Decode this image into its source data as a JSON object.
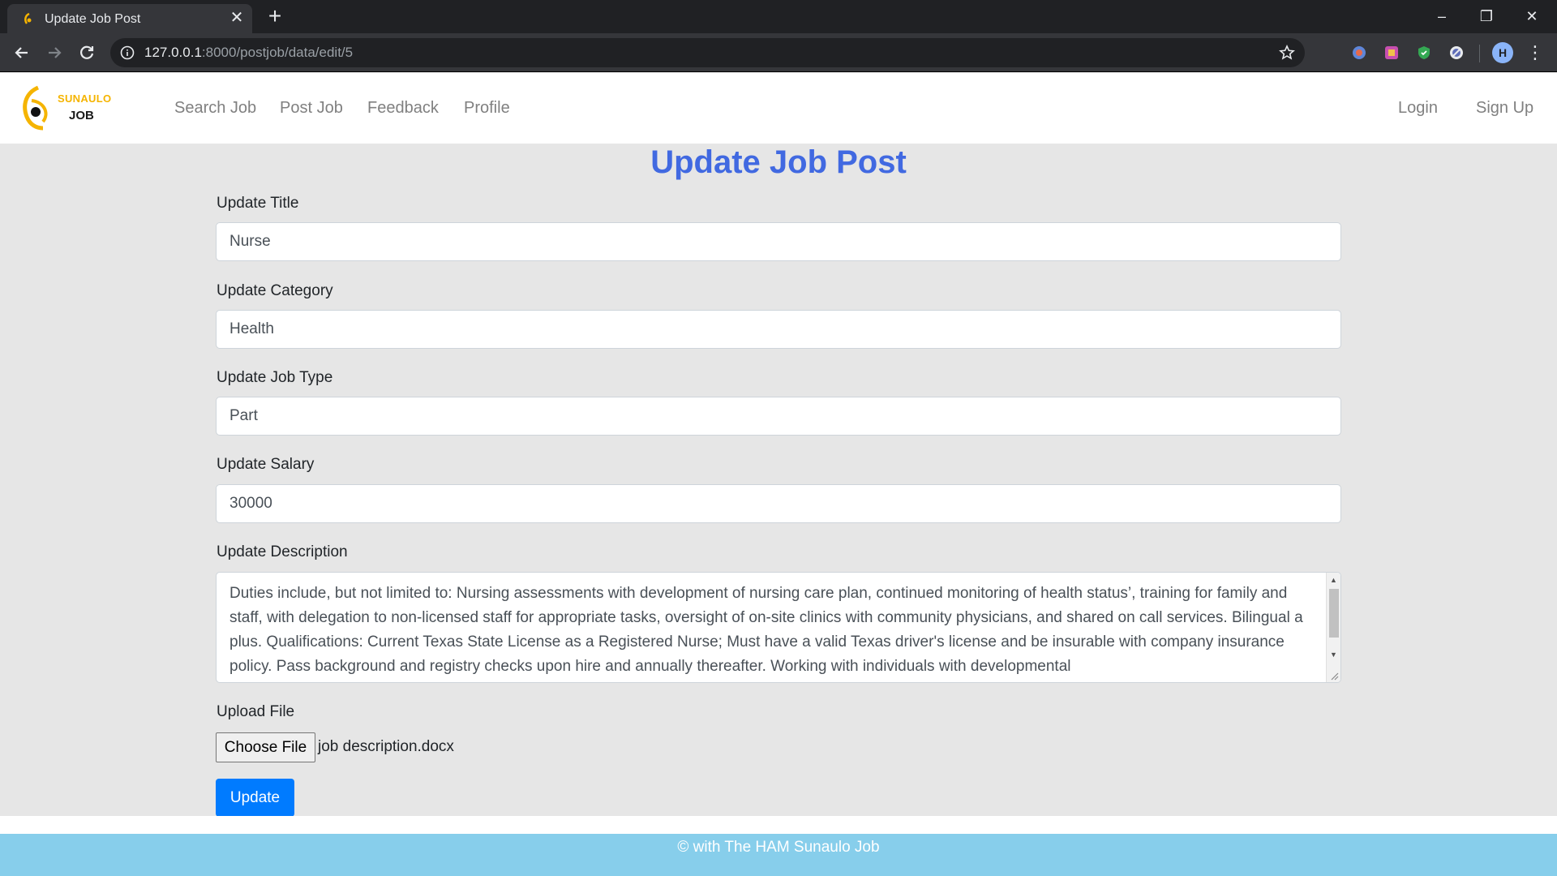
{
  "browser": {
    "tab_title": "Update Job Post",
    "tab_close": "✕",
    "new_tab": "+",
    "url_host": "127.0.0.1",
    "url_path": ":8000/postjob/data/edit/5",
    "window_controls": {
      "minimize": "–",
      "restore": "❐",
      "close": "✕"
    },
    "profile_initial": "H",
    "menu": "⋮"
  },
  "navbar": {
    "logo_top": "SUNAULO",
    "logo_bottom": "JOB",
    "links": [
      "Search Job",
      "Post Job",
      "Feedback",
      "Profile"
    ],
    "login": "Login",
    "signup": "Sign Up"
  },
  "form": {
    "heading": "Update Job Post",
    "title_label": "Update Title",
    "title_value": "Nurse",
    "category_label": "Update Category",
    "category_value": "Health",
    "jobtype_label": "Update Job Type",
    "jobtype_value": "Part",
    "salary_label": "Update Salary",
    "salary_value": "30000",
    "description_label": "Update Description",
    "description_value": "Duties include, but not limited to: Nursing assessments with development of nursing care plan, continued monitoring of health status’, training for family and staff, with delegation to non-licensed staff for appropriate tasks, oversight of on-site clinics with community physicians, and shared on call services. Bilingual a plus. Qualifications: Current Texas State License as a Registered Nurse; Must have a valid Texas driver's license and be insurable with company insurance policy. Pass background and registry checks upon hire and annually thereafter. Working with individuals with developmental",
    "file_label": "Upload File",
    "file_button": "Choose File",
    "file_name": "job description.docx",
    "submit": "Update"
  },
  "footer": {
    "text": "© with The HAM Sunaulo Job"
  },
  "colors": {
    "heading": "#4169e1",
    "primary_button": "#007bff",
    "footer_bg": "#87ceeb",
    "logo_accent": "#f5b400"
  }
}
